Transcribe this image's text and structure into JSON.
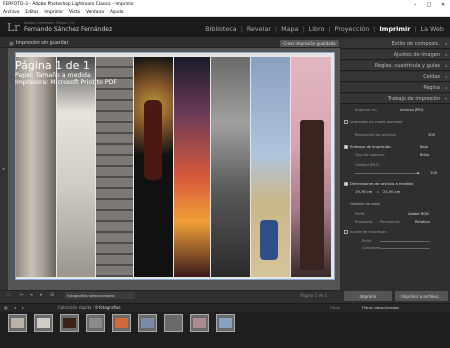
{
  "window": {
    "title": "FERFOTO-3 - Adobe Photoshop Lightroom Classic - Imprimir"
  },
  "menu": [
    "Archivo",
    "Editar",
    "Imprimir",
    "Vista",
    "Ventana",
    "Ayuda"
  ],
  "identity": {
    "logo": "Lr",
    "product": "Adobe Lightroom Classic CC",
    "user": "Fernando Sánchez Fernández"
  },
  "modules": [
    "Biblioteca",
    "Revelar",
    "Mapa",
    "Libro",
    "Proyección",
    "Imprimir",
    "La Web"
  ],
  "active_module": "Imprimir",
  "print": {
    "unsaved": "Impresión sin guardar",
    "save_button": "Crear impresión guardada",
    "page_label": "Página 1 de 1",
    "paper_line": "Papel: Tamaño a medida",
    "printer_line": "Impresora: Microsoft Print to PDF",
    "page_count": "Página 1 de 1"
  },
  "right_panel": {
    "sections": [
      "Estilo de composic.",
      "Ajustes de imagen",
      "Reglas, cuadrícula y guías",
      "Celdas",
      "Página",
      "Trabajo de impresión"
    ],
    "job": {
      "print_to_label": "Imprimir en:",
      "print_to_value": "Archivo JPEG",
      "draft_label": "Impresión en modo borrador",
      "resolution_label": "Resolución de archivo:",
      "resolution_value": "300",
      "sharpen_label": "Enfoque de impresión:",
      "sharpen_value": "Bajo",
      "media_label": "Tipo de soporte:",
      "media_value": "Brillo",
      "quality_label": "Calidad JPEG:",
      "quality_value": "100",
      "custom_dims_label": "Dimensiones de archivo a medida:",
      "dim_w": "19,76 cm",
      "dim_x": "x",
      "dim_h": "21,00 cm",
      "color_mgmt": "Gestión de color",
      "profile_label": "Perfil:",
      "profile_value": "Adobe RGB",
      "intent_label": "Propósito:",
      "intent_perceptual": "Perceptual",
      "intent_relative": "Relativo",
      "adjust_label": "Ajuste de impresión",
      "brightness_label": "Brillo",
      "contrast_label": "Contraste"
    }
  },
  "toolbar": {
    "selector": "Fotografías seleccionadas",
    "page": "Página 1 de 1",
    "print_btn": "Imprimir",
    "print_file_btn": "Imprimir a archivo..."
  },
  "filmstrip": {
    "collection": "Colección rápida",
    "count": "9 fotografías",
    "filter_label": "Filtro:",
    "filter_value": "Filtros desactivados"
  },
  "colors": {
    "accent": "#7aa2d0",
    "bg": "#2b2b2b"
  }
}
